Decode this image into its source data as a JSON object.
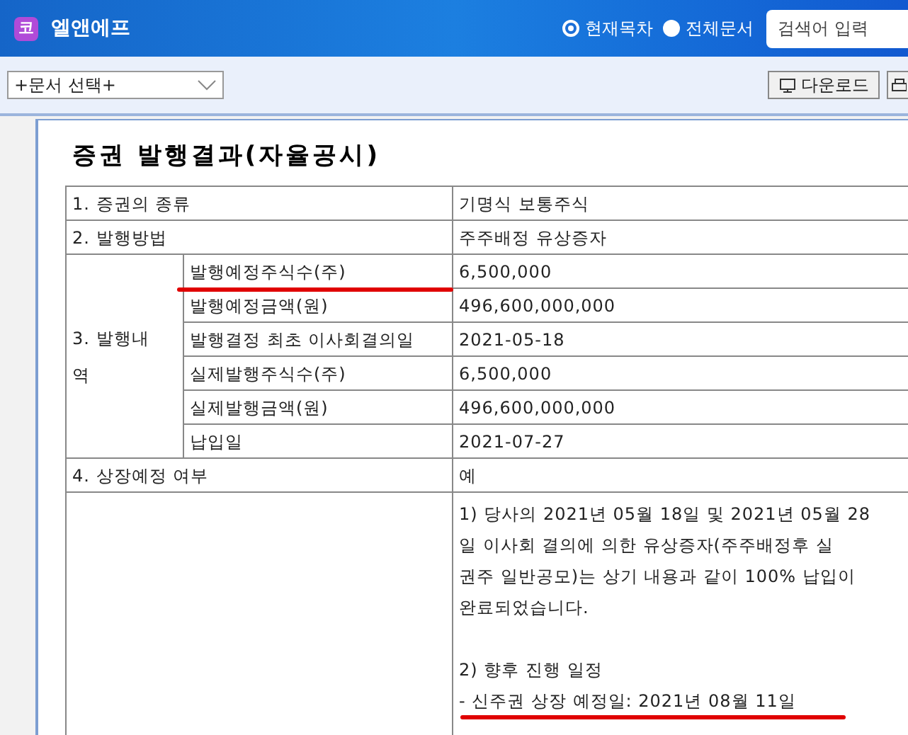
{
  "header": {
    "logo_text": "코",
    "title": "엘앤에프",
    "scope_options": [
      {
        "label": "현재목차",
        "selected": true
      },
      {
        "label": "전체문서",
        "selected": false
      }
    ],
    "search": {
      "placeholder": "검색어 입력"
    }
  },
  "toolbar": {
    "document_select": {
      "value": "+문서 선택+"
    },
    "download_button": "다운로드"
  },
  "document": {
    "title": "증권 발행결과(자율공시)",
    "rows": [
      {
        "kind": "plain",
        "label": "1. 증권의 종류",
        "value": "기명식 보통주식"
      },
      {
        "kind": "plain",
        "label": "2. 발행방법",
        "value": "주주배정 유상증자"
      },
      {
        "kind": "group",
        "label": "3. 발행내역",
        "items": [
          {
            "label": "발행예정주식수(주)",
            "value": "6,500,000"
          },
          {
            "label": "발행예정금액(원)",
            "value": "496,600,000,000"
          },
          {
            "label": "발행결정 최초 이사회결의일",
            "value": "2021-05-18"
          },
          {
            "label": "실제발행주식수(주)",
            "value": "6,500,000"
          },
          {
            "label": "실제발행금액(원)",
            "value": "496,600,000,000"
          },
          {
            "label": "납입일",
            "value": "2021-07-27"
          }
        ]
      },
      {
        "kind": "plain",
        "label": "4. 상장예정 여부",
        "value": "예"
      },
      {
        "kind": "notes",
        "paragraphs": [
          [
            "1) 당사의 2021년 05월 18일 및 2021년 05월 28",
            "일 이사회 결의에 의한 유상증자(주주배정후 실",
            "권주 일반공모)는 상기 내용과 같이 100% 납입이",
            "완료되었습니다."
          ],
          [
            "2) 향후 진행 일정",
            "- 신주권 상장 예정일: 2021년 08월 11일"
          ]
        ]
      }
    ]
  }
}
